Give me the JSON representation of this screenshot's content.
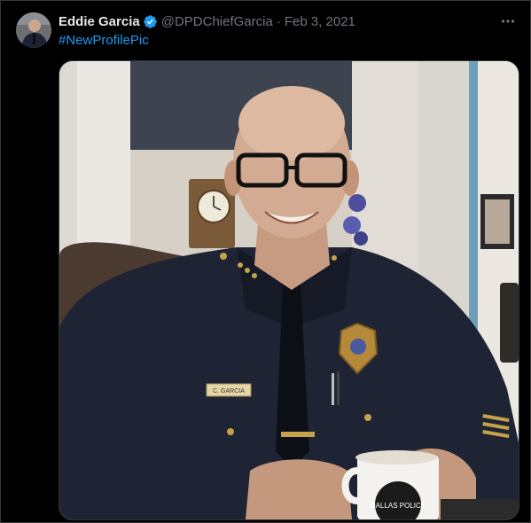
{
  "tweet": {
    "author_name": "Eddie Garcia",
    "handle": "@DPDChiefGarcia",
    "separator": "·",
    "date": "Feb 3, 2021",
    "hashtag": "#NewProfilePic"
  },
  "icons": {
    "verified": "verified-badge-icon",
    "more": "more-icon"
  },
  "photo": {
    "name_tag": "C. GARCIA",
    "mug_text": "DALLAS POLICE"
  },
  "colors": {
    "background": "#000000",
    "link": "#1d9bf0",
    "muted": "#71767b",
    "text": "#e7e9ea",
    "verified": "#1d9bf0"
  }
}
